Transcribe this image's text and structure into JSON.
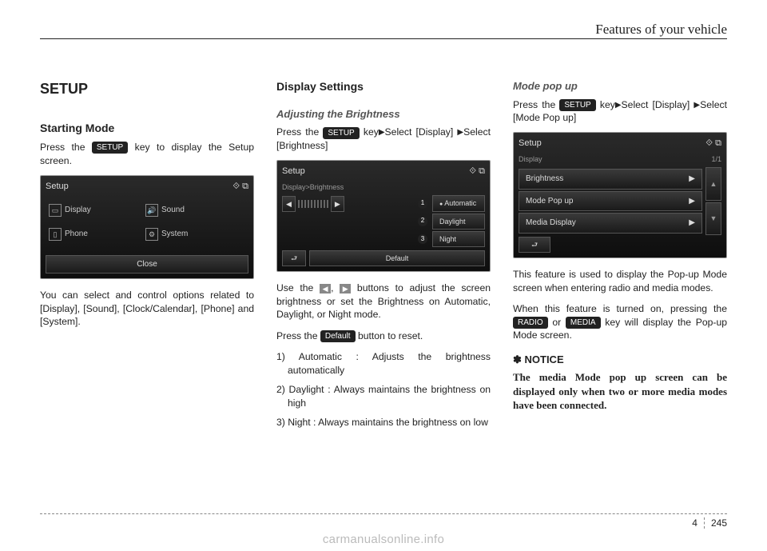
{
  "header": {
    "title": "Features of your vehicle"
  },
  "col1": {
    "h1": "SETUP",
    "h2": "Starting Mode",
    "p1a": "Press the ",
    "key_setup": "SETUP",
    "p1b": " key to display the Setup screen.",
    "shot": {
      "title": "Setup",
      "display": "Display",
      "sound": "Sound",
      "phone": "Phone",
      "system": "System",
      "close": "Close"
    },
    "p2": "You can select and control options related to [Display], [Sound], [Clock/Calendar], [Phone] and [System]."
  },
  "col2": {
    "h2": "Display Settings",
    "h3": "Adjusting the Brightness",
    "p1a": "Press the ",
    "key_setup": "SETUP",
    "p1b": " key",
    "p1c": "Select [Display] ",
    "p1d": "Select [Brightness]",
    "shot": {
      "title": "Setup",
      "crumb": "Display>Brightness",
      "auto": "Automatic",
      "day": "Daylight",
      "night": "Night",
      "default": "Default"
    },
    "p2a": "Use the ",
    "p2b": ", ",
    "p2c": " buttons to adjust the screen brightness or set the Brightness on Automatic, Daylight, or Night mode.",
    "p3a": "Press the ",
    "key_default": "Default",
    "p3b": " button to reset.",
    "li1": "1) Automatic : Adjusts the brightness automatically",
    "li2": "2) Daylight : Always maintains the brightness on high",
    "li3": "3) Night : Always maintains the brightness on low"
  },
  "col3": {
    "h3": "Mode pop up",
    "p1a": "Press the ",
    "key_setup": "SETUP",
    "p1b": " key",
    "p1c": "Select [Display] ",
    "p1d": "Select [Mode Pop up]",
    "shot": {
      "title": "Setup",
      "crumb": "Display",
      "page": "1/1",
      "row1": "Brightness",
      "row2": "Mode Pop up",
      "row3": "Media Display"
    },
    "p2": "This feature is used to display the Pop-up Mode screen when entering radio and media modes.",
    "p3a": "When this feature is turned on, pressing the ",
    "key_radio": "RADIO",
    "p3b": " or ",
    "key_media": "MEDIA",
    "p3c": " key will display the Pop-up Mode screen.",
    "notice_h": "✽ NOTICE",
    "notice": "The media Mode pop up screen can be displayed only when two or more media modes have been connected."
  },
  "footer": {
    "section": "4",
    "page": "245"
  },
  "watermark": "carmanualsonline.info"
}
